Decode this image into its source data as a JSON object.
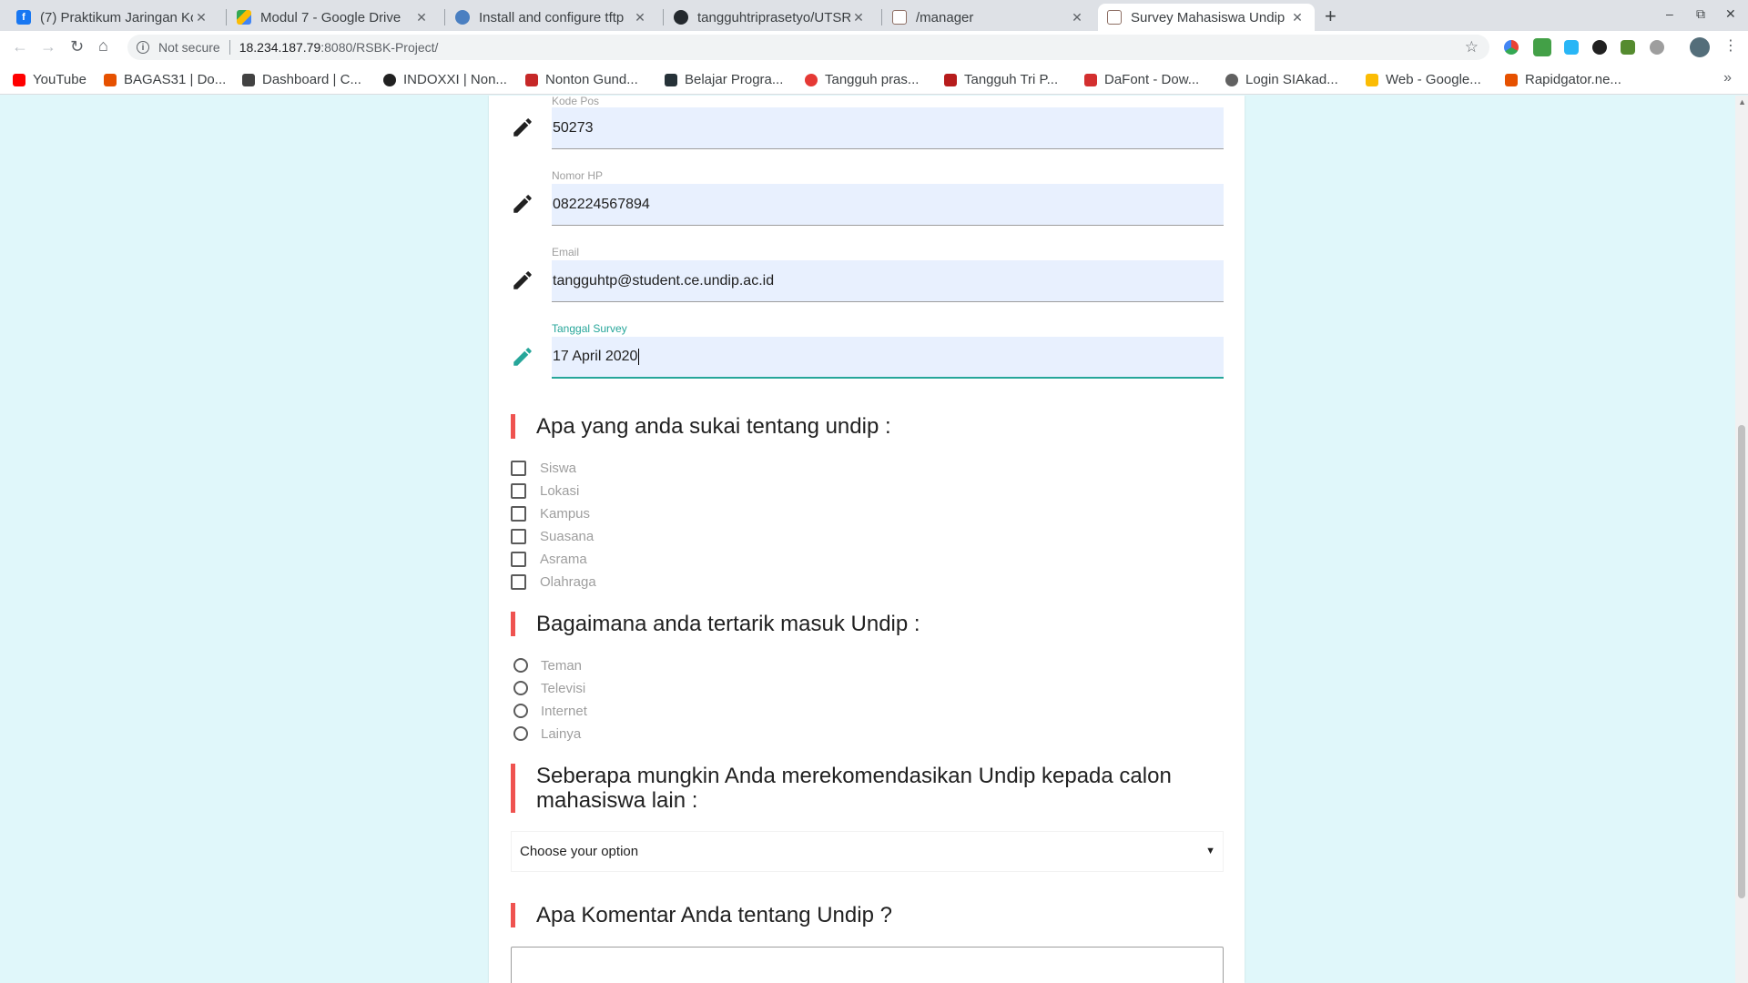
{
  "browser": {
    "tabs": [
      {
        "title": "(7) Praktikum Jaringan Ko",
        "icon": "facebook-icon",
        "color": "#1877f2"
      },
      {
        "title": "Modul 7 - Google Drive",
        "icon": "google-drive-icon",
        "color": "#fbbc04"
      },
      {
        "title": "Install and configure tftp",
        "icon": "globe-icon",
        "color": "#4a7fc1"
      },
      {
        "title": "tangguhtriprasetyo/UTSR",
        "icon": "github-icon",
        "color": "#24292e"
      },
      {
        "title": "/manager",
        "icon": "tomcat-icon",
        "color": "#8d6e63"
      },
      {
        "title": "Survey Mahasiswa Undip",
        "icon": "survey-icon",
        "color": "#8d6e63"
      }
    ],
    "new_tab": "+",
    "window_controls": [
      "–",
      "⧉",
      "✕"
    ],
    "address": {
      "security": "Not secure",
      "host": "18.234.187.79",
      "path": ":8080/RSBK-Project/"
    },
    "bookmarks": [
      {
        "label": "YouTube",
        "color": "#ff0000"
      },
      {
        "label": "BAGAS31 | Do...",
        "color": "#e65100"
      },
      {
        "label": "Dashboard | C...",
        "color": "#424242"
      },
      {
        "label": "INDOXXI | Non...",
        "color": "#212121"
      },
      {
        "label": "Nonton Gund...",
        "color": "#c62828"
      },
      {
        "label": "Belajar Progra...",
        "color": "#263238"
      },
      {
        "label": "Tangguh pras...",
        "color": "#e53935"
      },
      {
        "label": "Tangguh Tri P...",
        "color": "#b71c1c"
      },
      {
        "label": "DaFont - Dow...",
        "color": "#d32f2f"
      },
      {
        "label": "Login SIAkad...",
        "color": "#616161"
      },
      {
        "label": "Web - Google...",
        "color": "#fbbc04"
      },
      {
        "label": "Rapidgator.ne...",
        "color": "#e65100"
      }
    ]
  },
  "form": {
    "fields": [
      {
        "label": "Kode Pos",
        "value": "50273"
      },
      {
        "label": "Nomor HP",
        "value": "082224567894"
      },
      {
        "label": "Email",
        "value": "tangguhtp@student.ce.undip.ac.id"
      },
      {
        "label": "Tanggal Survey",
        "value": "17 April 2020"
      }
    ],
    "q1": {
      "title": "Apa yang anda sukai tentang undip :",
      "options": [
        "Siswa",
        "Lokasi",
        "Kampus",
        "Suasana",
        "Asrama",
        "Olahraga"
      ]
    },
    "q2": {
      "title": "Bagaimana anda tertarik masuk Undip :",
      "options": [
        "Teman",
        "Televisi",
        "Internet",
        "Lainya"
      ]
    },
    "q3": {
      "title": "Seberapa mungkin Anda merekomendasikan Undip kepada calon mahasiswa lain :",
      "selected": "Choose your option"
    },
    "q4": {
      "title": "Apa Komentar Anda tentang Undip ?"
    }
  },
  "colors": {
    "page_bg": "#e0f7fa",
    "accent_teal": "#26a69a",
    "heading_bar": "#ef5350",
    "input_bg": "#e8f0fe"
  }
}
